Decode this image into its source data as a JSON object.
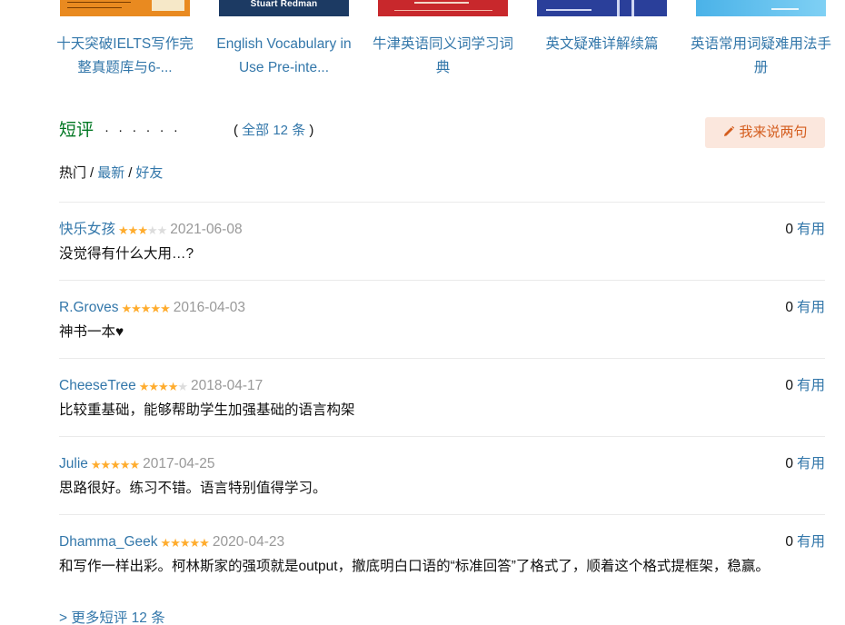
{
  "related_books": [
    {
      "title": "十天突破IELTS写作完整真题库与6-...",
      "cover": "orange-cover"
    },
    {
      "title": "English Vocabulary in Use Pre-inte...",
      "cover": "navy-cover",
      "cover_text": "Stuart Redman"
    },
    {
      "title": "牛津英语同义词学习词典",
      "cover": "red-cover"
    },
    {
      "title": "英文疑难详解续篇",
      "cover": "blue-cover"
    },
    {
      "title": "英语常用词疑难用法手册",
      "cover": "sky-cover"
    }
  ],
  "short_reviews": {
    "title": "短评",
    "dots": "· · · · · ·",
    "count_open": "(",
    "count_label": "全部 12 条",
    "count_close": ")",
    "write_button": "我来说两句",
    "tabs": [
      {
        "label": "热门",
        "active": true
      },
      {
        "label": "最新",
        "active": false
      },
      {
        "label": "好友",
        "active": false
      }
    ],
    "tab_separator": "/",
    "helpful_label": "有用",
    "items": [
      {
        "user": "快乐女孩",
        "rating": 3,
        "date": "2021-06-08",
        "votes": "0",
        "text": "没觉得有什么大用…?"
      },
      {
        "user": "R.Groves",
        "rating": 5,
        "date": "2016-04-03",
        "votes": "0",
        "text": "神书一本♥"
      },
      {
        "user": "CheeseTree",
        "rating": 4,
        "date": "2018-04-17",
        "votes": "0",
        "text": "比较重基础，能够帮助学生加强基础的语言构架"
      },
      {
        "user": "Julie",
        "rating": 5,
        "date": "2017-04-25",
        "votes": "0",
        "text": "思路很好。练习不错。语言特别值得学习。"
      },
      {
        "user": "Dhamma_Geek",
        "rating": 5,
        "date": "2020-04-23",
        "votes": "0",
        "text": "和写作一样出彩。柯林斯家的强项就是output，撤底明白口语的“标准回答”了格式了，顺着这个格式提框架，稳赢。"
      }
    ],
    "more_link": "> 更多短评 12 条"
  },
  "colors": {
    "link": "#3377aa",
    "heading_green": "#007722",
    "star": "#ffac2d",
    "button_bg": "#fbe7dd",
    "button_text": "#d45d1e"
  }
}
